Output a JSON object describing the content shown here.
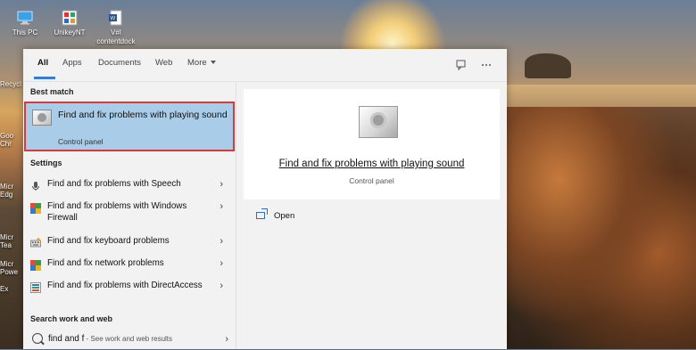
{
  "desktop": {
    "icons": [
      {
        "label": "This PC"
      },
      {
        "label": "UnikeyNT"
      },
      {
        "label": "V#I contentdock"
      }
    ],
    "left_labels": [
      "Recycl",
      "Goo Chr",
      "Micr Edg",
      "Micr Tea",
      "Micr Powe",
      "Ex"
    ]
  },
  "search_panel": {
    "tabs": [
      {
        "label": "All"
      },
      {
        "label": "Apps"
      },
      {
        "label": "Documents"
      },
      {
        "label": "Web"
      },
      {
        "label": "More"
      }
    ],
    "best_match_heading": "Best match",
    "best_match": {
      "title": "Find and fix problems with playing sound",
      "subtitle": "Control panel"
    },
    "settings_heading": "Settings",
    "settings_items": [
      {
        "label": "Find and fix problems with Speech",
        "icon": "microphone-icon"
      },
      {
        "label": "Find and fix problems with Windows Firewall",
        "icon": "firewall-icon"
      },
      {
        "label": "Find and fix keyboard problems",
        "icon": "keyboard-icon"
      },
      {
        "label": "Find and fix network problems",
        "icon": "network-icon"
      },
      {
        "label": "Find and fix problems with DirectAccess",
        "icon": "directaccess-icon"
      }
    ],
    "search_web_heading": "Search work and web",
    "search_web": {
      "query": "find and f",
      "hint": " - See work and web results"
    },
    "detail": {
      "title": "Find and fix problems with playing sound",
      "subtitle": "Control panel",
      "actions": [
        {
          "label": "Open"
        }
      ]
    }
  },
  "colors": {
    "accent": "#3a7bd5",
    "selected_bg": "#a9cce8",
    "selected_border": "#d83a3a"
  }
}
